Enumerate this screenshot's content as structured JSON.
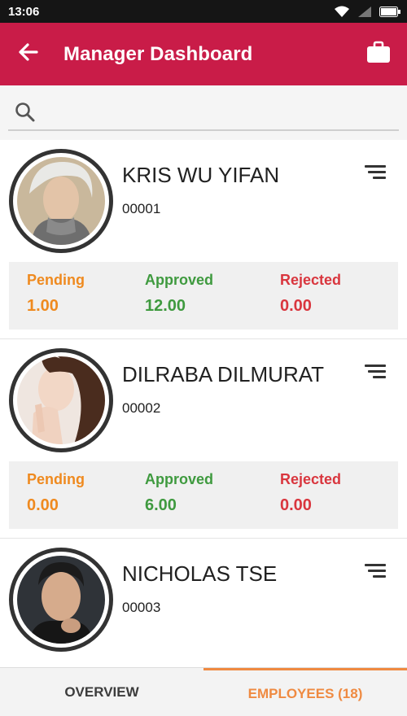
{
  "status_bar": {
    "time": "13:06"
  },
  "app_bar": {
    "title": "Manager Dashboard"
  },
  "search": {
    "value": "",
    "placeholder": ""
  },
  "employees": [
    {
      "name": "KRIS WU YIFAN",
      "id": "00001",
      "stats": [
        {
          "label": "Pending",
          "value": "1.00"
        },
        {
          "label": "Approved",
          "value": "12.00"
        },
        {
          "label": "Rejected",
          "value": "0.00"
        }
      ]
    },
    {
      "name": "DILRABA DILMURAT",
      "id": "00002",
      "stats": [
        {
          "label": "Pending",
          "value": "0.00"
        },
        {
          "label": "Approved",
          "value": "6.00"
        },
        {
          "label": "Rejected",
          "value": "0.00"
        }
      ]
    },
    {
      "name": "NICHOLAS TSE",
      "id": "00003",
      "stats": []
    }
  ],
  "bottom_nav": {
    "tabs": [
      {
        "label": "OVERVIEW",
        "active": false
      },
      {
        "label": "EMPLOYEES (18)",
        "active": true
      }
    ]
  },
  "colors": {
    "app_bar": "#c91c48",
    "pending": "#ef8a1f",
    "approved": "#3f9a3f",
    "rejected": "#d9363e",
    "active_tab": "#ef8a41"
  },
  "icons": {
    "back": "arrow-left-icon",
    "briefcase": "briefcase-icon",
    "search": "search-icon",
    "menu": "sort-menu-icon",
    "wifi": "wifi-icon",
    "signal": "signal-icon",
    "battery": "battery-icon"
  }
}
